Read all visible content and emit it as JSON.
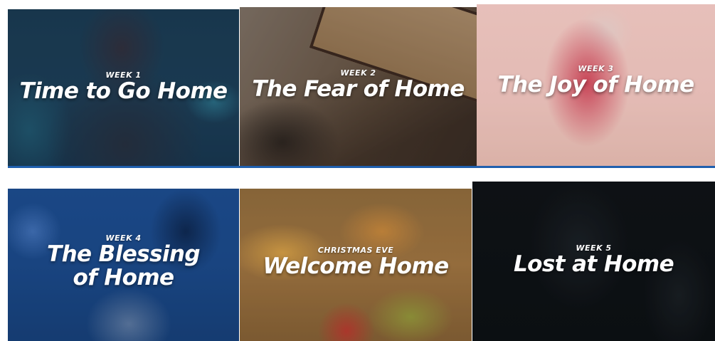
{
  "series": [
    {
      "eyebrow": "WEEK 1",
      "title": "Time to Go Home"
    },
    {
      "eyebrow": "WEEK 2",
      "title": "The Fear of Home"
    },
    {
      "eyebrow": "WEEK 3",
      "title": "The Joy of Home"
    },
    {
      "eyebrow": "WEEK 4",
      "title": "The Blessing of Home"
    },
    {
      "eyebrow": "CHRISTMAS EVE",
      "title": "Welcome Home"
    },
    {
      "eyebrow": "WEEK 5",
      "title": "Lost at Home"
    }
  ],
  "colors": {
    "divider": "#1f5fae",
    "text": "#ffffff"
  }
}
